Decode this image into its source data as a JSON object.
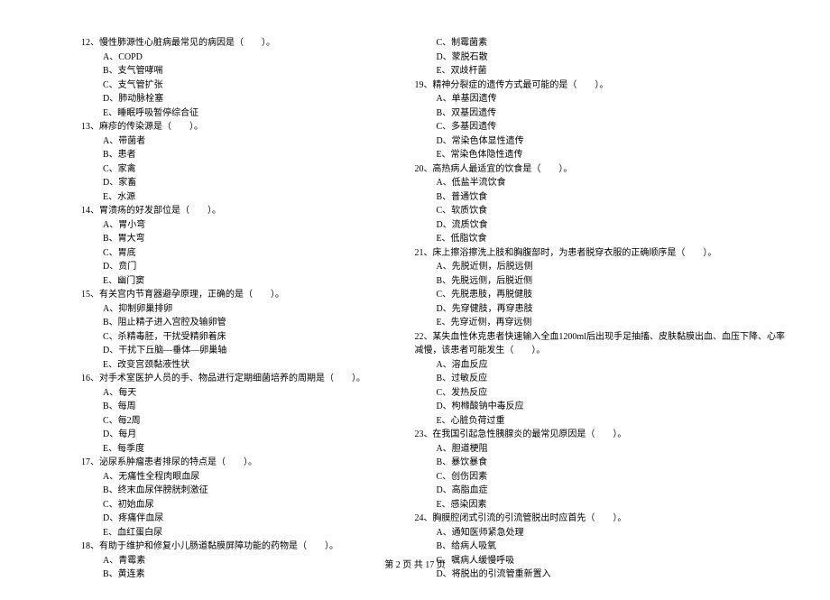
{
  "footer": "第 2 页 共 17 页",
  "left_column": [
    {
      "q": "12、慢性肺源性心脏病最常见的病因是（　　）。",
      "opts": [
        "A、COPD",
        "B、支气管哮喘",
        "C、支气管扩张",
        "D、肺动脉栓塞",
        "E、睡眠呼吸暂停综合征"
      ]
    },
    {
      "q": "13、麻疹的传染源是（　　）。",
      "opts": [
        "A、带菌者",
        "B、患者",
        "C、家禽",
        "D、家畜",
        "E、水源"
      ]
    },
    {
      "q": "14、胃溃疡的好发部位是（　　）。",
      "opts": [
        "A、胃小弯",
        "B、胃大弯",
        "C、胃底",
        "D、贲门",
        "E、幽门窦"
      ]
    },
    {
      "q": "15、有关宫内节育器避孕原理，正确的是（　　）。",
      "opts": [
        "A、抑制卵巢排卵",
        "B、阻止精子进入宫腔及输卵管",
        "C、杀精毒胚，干扰受精卵着床",
        "D、干扰下丘脑—垂体—卵巢轴",
        "E、改变宫颈黏液性状"
      ]
    },
    {
      "q": "16、对手术室医护人员的手、物品进行定期细菌培养的周期是（　　）。",
      "opts": [
        "A、每天",
        "B、每周",
        "C、每2周",
        "D、每月",
        "E、每季度"
      ]
    },
    {
      "q": "17、泌尿系肿瘤患者排尿的特点是（　　）。",
      "opts": [
        "A、无痛性全程肉眼血尿",
        "B、终末血尿伴膀胱刺激征",
        "C、初始血尿",
        "D、疼痛伴血尿",
        "E、血红蛋白尿"
      ]
    },
    {
      "q": "18、有助于维护和修复小儿肠道黏膜屏障功能的药物是（　　）。",
      "opts": [
        "A、青霉素",
        "B、黄连素"
      ]
    }
  ],
  "right_column_pre_opts": [
    "C、制霉菌素",
    "D、蒙脱石散",
    "E、双歧杆菌"
  ],
  "right_column": [
    {
      "q": "19、精神分裂症的遗传方式最可能的是（　　）。",
      "opts": [
        "A、单基因遗传",
        "B、双基因遗传",
        "C、多基因遗传",
        "D、常染色体显性遗传",
        "E、常染色体隐性遗传"
      ]
    },
    {
      "q": "20、高热病人最适宜的饮食是（　　）。",
      "opts": [
        "A、低盐半流饮食",
        "B、普通饮食",
        "C、软质饮食",
        "D、流质饮食",
        "E、低脂饮食"
      ]
    },
    {
      "q": "21、床上擦浴擦洗上肢和胸腹部时，为患者脱穿衣服的正确顺序是（　　）。",
      "opts": [
        "A、先脱近侧，后脱远侧",
        "B、先脱远侧，后脱近侧",
        "C、先脱患肢，再脱健肢",
        "D、先穿健肢，再穿患肢",
        "E、先穿近侧，再穿远侧"
      ]
    },
    {
      "q": "22、某失血性休克患者快速输入全血1200ml后出现手足抽搐、皮肤黏膜出血、血压下降、心率",
      "q2": "减慢，该患者可能发生（　　）。",
      "opts": [
        "A、溶血反应",
        "B、过敏反应",
        "C、发热反应",
        "D、枸橼酸钠中毒反应",
        "E、心脏负荷过重"
      ]
    },
    {
      "q": "23、在我国引起急性胰腺炎的最常见原因是（　　）。",
      "opts": [
        "A、胆道梗阻",
        "B、暴饮暴食",
        "C、创伤因素",
        "D、高脂血症",
        "E、感染因素"
      ]
    },
    {
      "q": "24、胸膜腔闭式引流的引流管脱出时应首先（　　）。",
      "opts": [
        "A、通知医师紧急处理",
        "B、给病人吸氧",
        "C、嘱病人缓慢呼吸",
        "D、将脱出的引流管重新置入"
      ]
    }
  ]
}
